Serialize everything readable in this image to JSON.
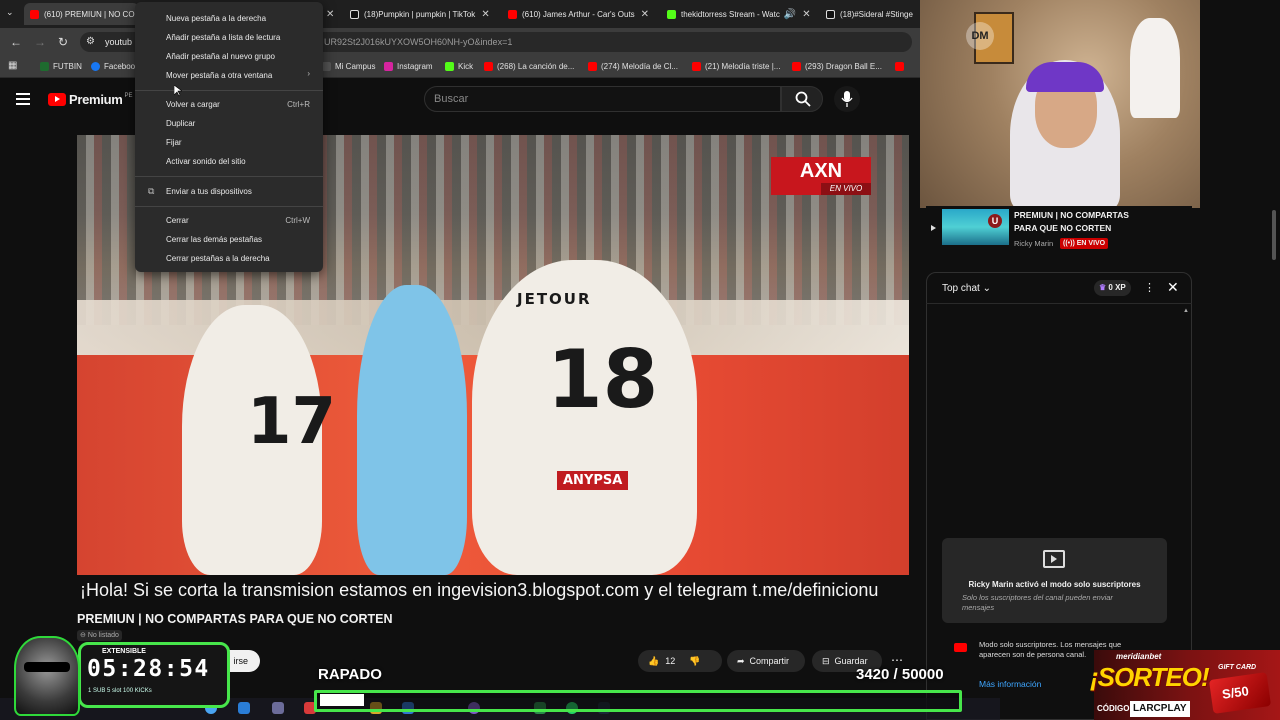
{
  "tabs": [
    {
      "label": "(610) PREMIUN | NO CO",
      "color": "#ff0000",
      "active": true
    },
    {
      "label": "(18)Pumpkin | pumpkin | TikTok",
      "color": "#111111"
    },
    {
      "label": "(610) James Arthur - Car's Outs",
      "color": "#ff0000"
    },
    {
      "label": "thekidtorress Stream - Watc",
      "color": "#53fc18"
    },
    {
      "label": "(18)#Sideral #Stinge",
      "color": "#111111"
    }
  ],
  "address": {
    "host": "youtub",
    "rest": "UR92St2J016kUYXOW5OH60NH-yO&index=1"
  },
  "bookmarks": [
    "FUTBIN",
    "Faceboo",
    "Mi Campus",
    "Instagram",
    "Kick",
    "(268) La canción de...",
    "(274) Melodía de Cl...",
    "(21) Melodía triste |...",
    "(293) Dragon Ball E..."
  ],
  "context_menu": {
    "items": [
      {
        "label": "Nueva pestaña a la derecha"
      },
      {
        "label": "Añadir pestaña a lista de lectura"
      },
      {
        "label": "Añadir pestaña al nuevo grupo"
      },
      {
        "label": "Mover pestaña a otra ventana",
        "submenu": "›"
      },
      {
        "label": "Volver a cargar",
        "shortcut": "Ctrl+R"
      },
      {
        "label": "Duplicar"
      },
      {
        "label": "Fijar"
      },
      {
        "label": "Activar sonido del sitio"
      },
      {
        "label": "Enviar a tus dispositivos"
      },
      {
        "label": "Cerrar",
        "shortcut": "Ctrl+W"
      },
      {
        "label": "Cerrar las demás pestañas"
      },
      {
        "label": "Cerrar pestañas a la derecha"
      }
    ]
  },
  "header": {
    "brand": "Premium",
    "brand_suffix": "PE",
    "search_placeholder": "Buscar"
  },
  "video": {
    "broadcaster": "AXN",
    "broadcaster_sub": "EN VIVO",
    "jersey_numbers": [
      "17",
      "18"
    ],
    "sponsor": "JETOUR",
    "sponsor2": "ANYPSA",
    "subtitle": "¡Hola! Si se corta la transmision estamos en ingevision3.blogspot.com y el telegram t.me/definicionu",
    "title": "PREMIUN | NO COMPARTAS PARA QUE NO CORTEN",
    "unlisted": "No listado"
  },
  "actions": {
    "subscribe": "irse",
    "likes": "12",
    "share": "Compartir",
    "save": "Guardar"
  },
  "miniplayer": {
    "title": "PREMIUN | NO COMPARTAS PARA QUE NO CORTEN",
    "author": "Ricky Marin",
    "live": "EN VIVO"
  },
  "chat": {
    "mode_label": "Top chat",
    "xp": "0 XP",
    "submode_title": "Ricky Marin activó el modo solo suscriptores",
    "submode_text": "Solo los suscriptores del canal pueden enviar mensajes",
    "notice_text": "Modo solo suscriptores. Los mensajes que aparecen son de persona canal.",
    "more_info": "Más información"
  },
  "overlay": {
    "timer_label": "EXTENSIBLE",
    "timer": "05:28:54",
    "timer_stats": "1 SUB  5 slot  100 KICKs",
    "goal_title": "RAPADO",
    "goal_current": 3420,
    "goal_target": 50000,
    "goal_text": "3420  / 50000",
    "promo_brand": "meridianbet",
    "promo_big": "¡SORTEO!",
    "promo_code_label": "CÓDIGO:",
    "promo_code": "LARCPLAY",
    "gift_label": "GIFT CARD",
    "gift_value": "S/50"
  },
  "webcam": {
    "logo": "DM"
  }
}
